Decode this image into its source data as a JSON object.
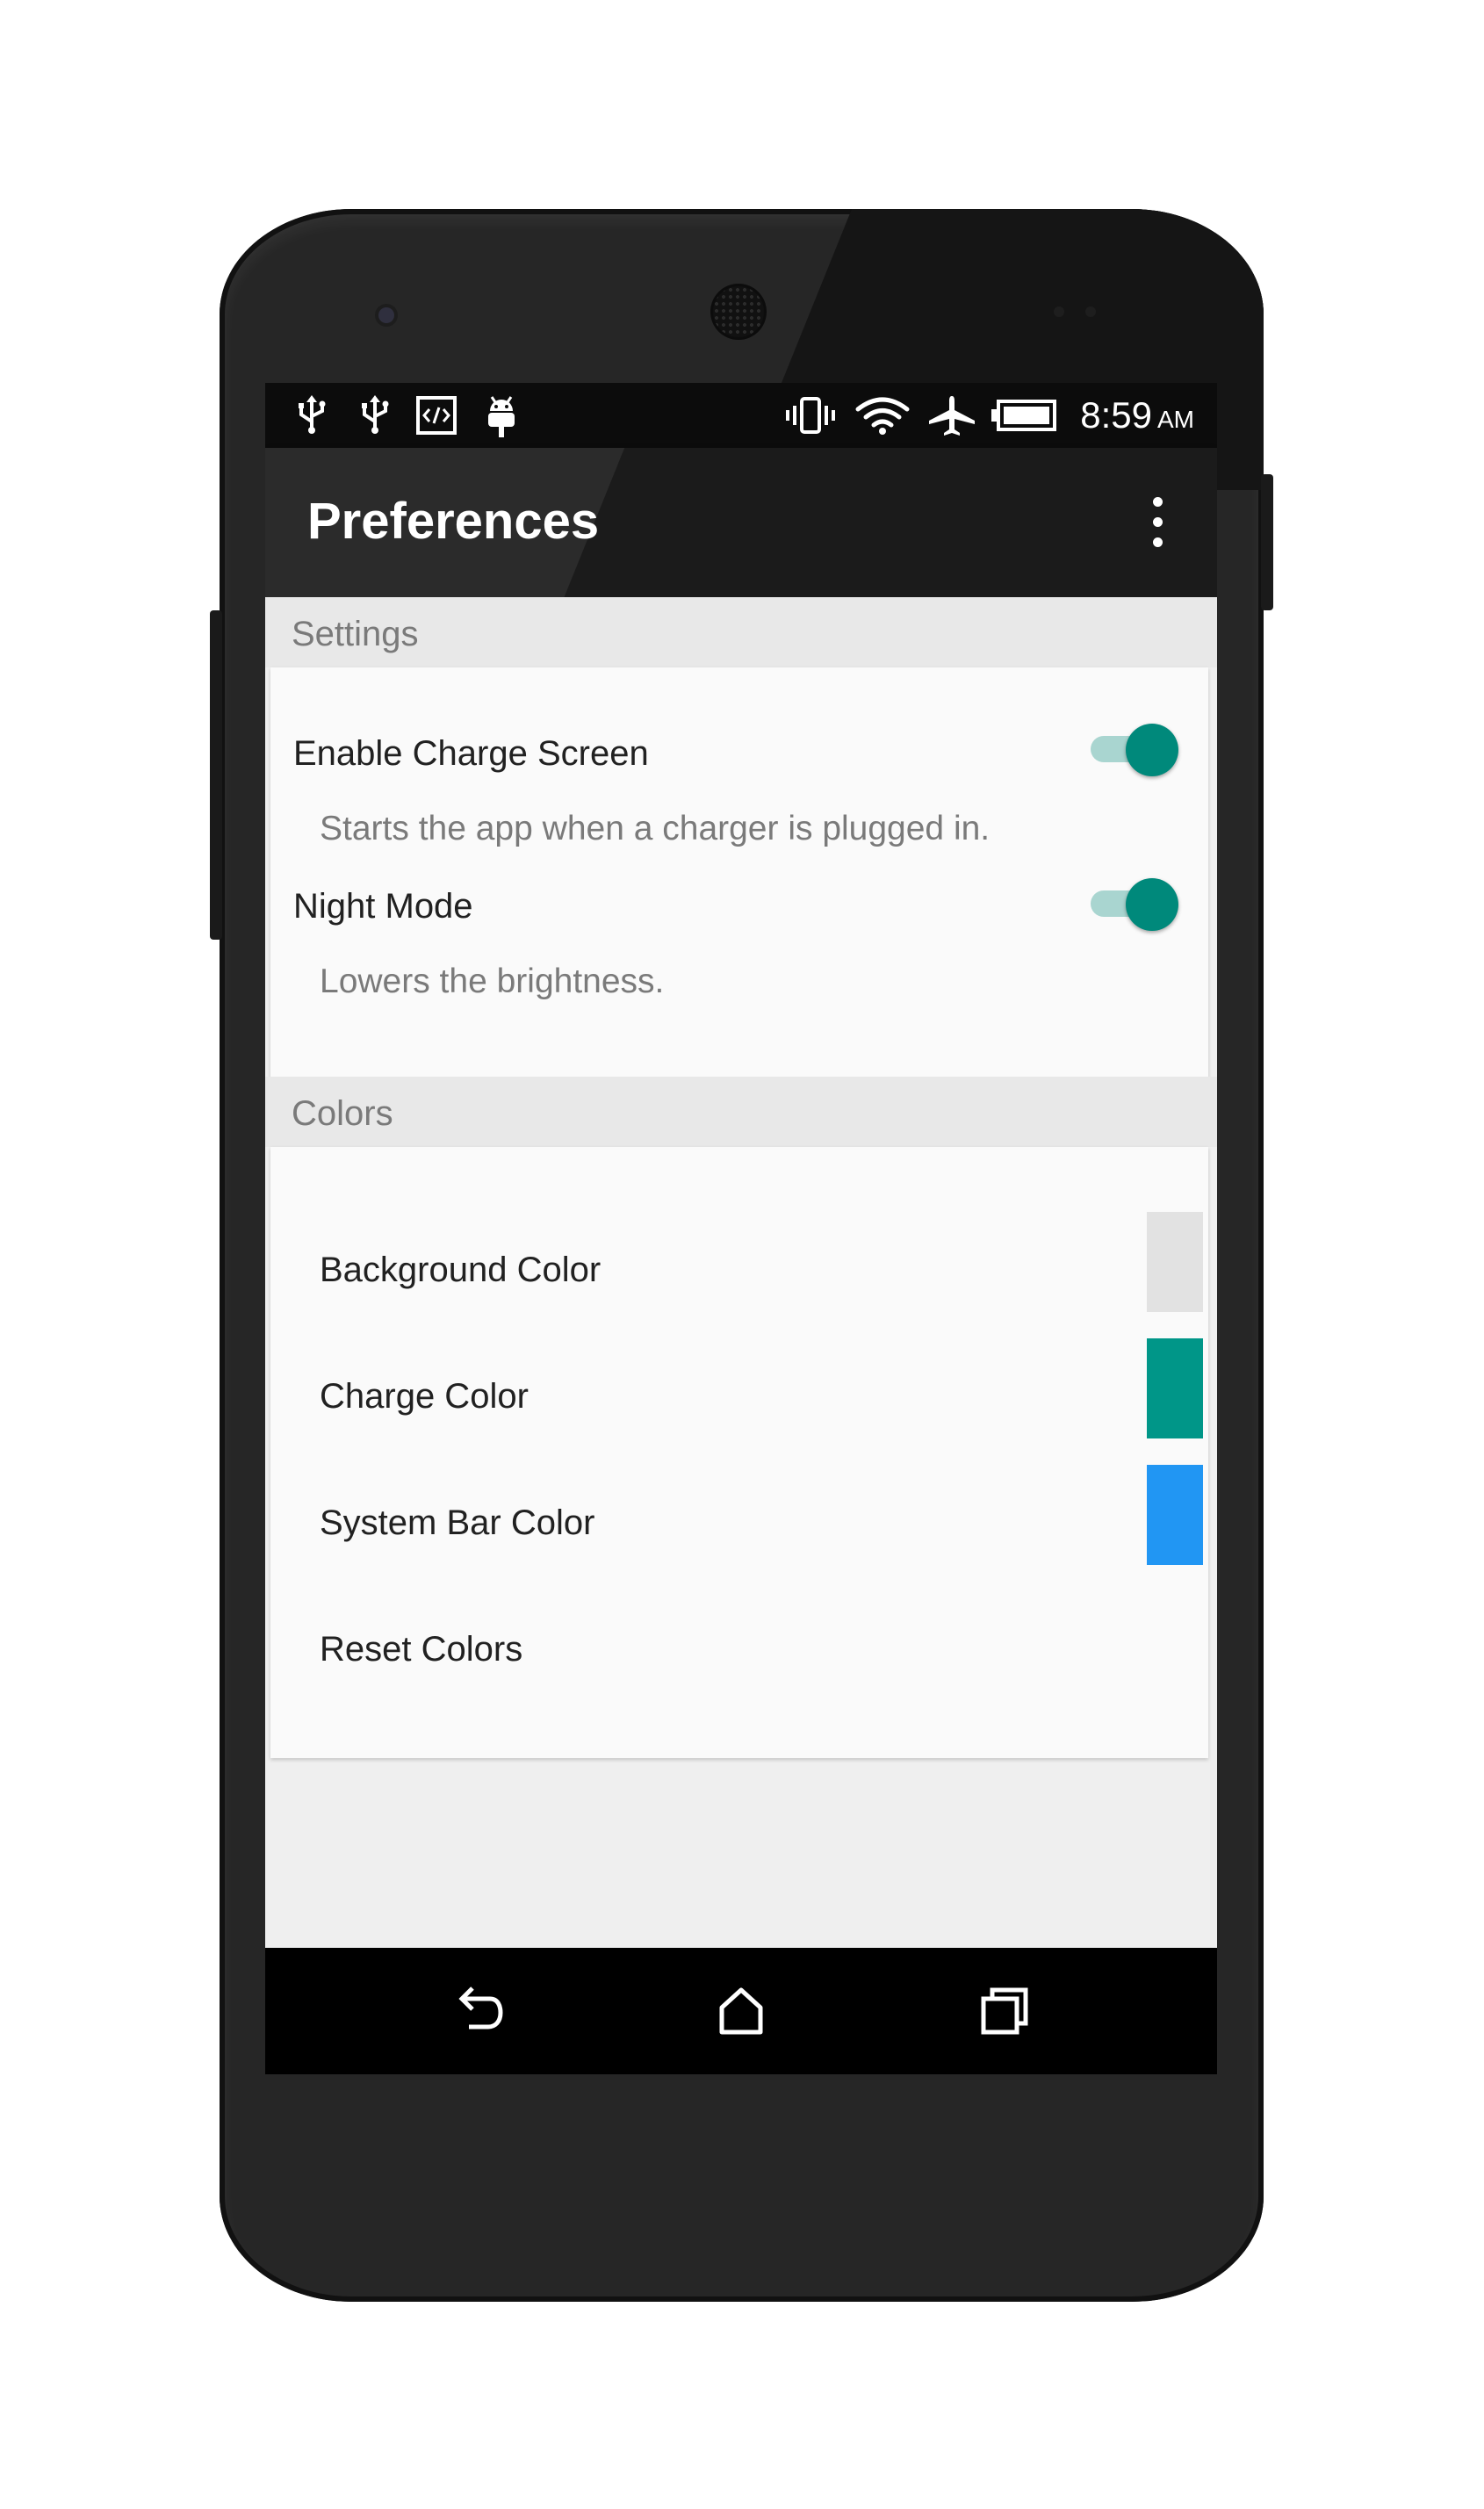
{
  "status_bar": {
    "left_icons": [
      "usb-icon",
      "usb-icon",
      "developer-code-icon",
      "android-debug-icon"
    ],
    "right_icons": [
      "vibrate-icon",
      "wifi-icon",
      "airplane-icon",
      "battery-icon"
    ],
    "time": "8:59",
    "ampm": "AM"
  },
  "app_bar": {
    "title": "Preferences",
    "menu_icon": "overflow-menu-icon"
  },
  "settings": {
    "header": "Settings",
    "items": [
      {
        "title": "Enable Charge Screen",
        "summary": "Starts the app when a charger is plugged in.",
        "checked": true
      },
      {
        "title": "Night Mode",
        "summary": "Lowers the brightness.",
        "checked": true
      }
    ]
  },
  "colors": {
    "header": "Colors",
    "items": [
      {
        "title": "Background Color",
        "swatch": "#e2e2e2"
      },
      {
        "title": "Charge Color",
        "swatch": "#009688"
      },
      {
        "title": "System Bar Color",
        "swatch": "#2196f3"
      },
      {
        "title": "Reset Colors"
      }
    ]
  },
  "theme": {
    "accent": "#00897b",
    "accent_track": "#a9d5d0"
  },
  "nav_bar": {
    "icons": [
      "back-icon",
      "home-icon",
      "recents-icon"
    ]
  }
}
